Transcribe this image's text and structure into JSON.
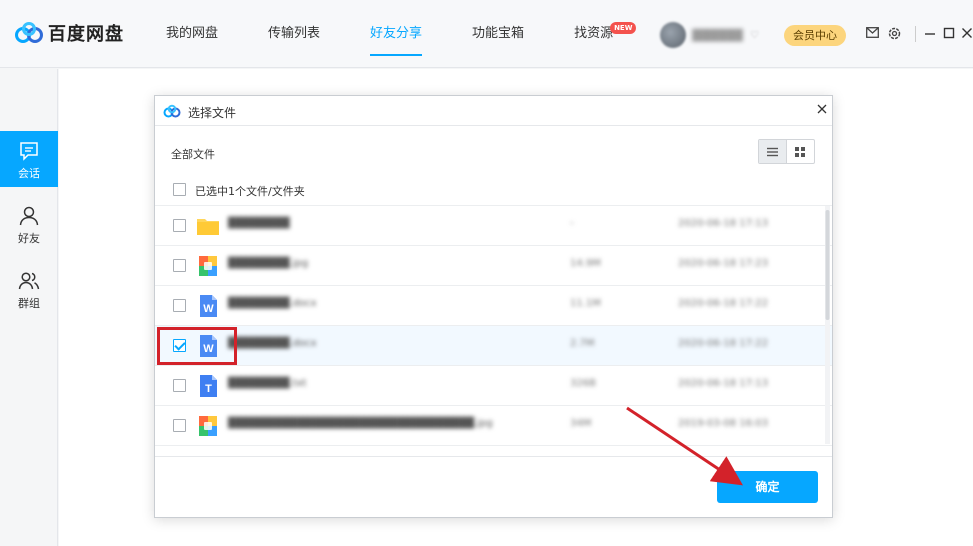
{
  "app": {
    "name": "百度网盘",
    "colors": {
      "accent": "#06a7ff",
      "vip": "#fcd57d",
      "annotation": "#d3222a",
      "badge": "#f4524d"
    }
  },
  "nav": {
    "items": [
      {
        "label": "我的网盘"
      },
      {
        "label": "传输列表"
      },
      {
        "label": "好友分享",
        "active": true
      },
      {
        "label": "功能宝箱"
      },
      {
        "label": "找资源",
        "badge": "NEW"
      }
    ]
  },
  "user": {
    "vip_label": "会员中心",
    "icons": [
      "mail-icon",
      "settings-icon",
      "minimize-icon",
      "maximize-icon",
      "close-icon"
    ]
  },
  "sidebar": {
    "items": [
      {
        "label": "会话",
        "icon": "chat-icon",
        "active": true
      },
      {
        "label": "好友",
        "icon": "friend-icon"
      },
      {
        "label": "群组",
        "icon": "group-icon"
      }
    ]
  },
  "dialog": {
    "title": "选择文件",
    "breadcrumb": "全部文件",
    "selected_text": "已选中1个文件/文件夹",
    "confirm_label": "确定",
    "files": [
      {
        "type": "folder-icon",
        "checked": false,
        "name": "████████",
        "size": "-",
        "date": "2020-06-18 17:13"
      },
      {
        "type": "image-icon",
        "checked": false,
        "name": "████████.jpg",
        "size": "14.9M",
        "date": "2020-06-18 17:23"
      },
      {
        "type": "word-icon",
        "checked": false,
        "name": "████████.docx",
        "size": "11.1M",
        "date": "2020-06-18 17:22"
      },
      {
        "type": "word-icon",
        "checked": true,
        "name": "████████.docx",
        "size": "2.7M",
        "date": "2020-06-18 17:22"
      },
      {
        "type": "text-icon",
        "checked": false,
        "name": "████████.txt",
        "size": "326B",
        "date": "2020-06-18 17:13"
      },
      {
        "type": "image-icon",
        "checked": false,
        "name": "████████████████████████████████.jpg",
        "size": "34M",
        "date": "2019-03-08 16:03"
      }
    ]
  }
}
